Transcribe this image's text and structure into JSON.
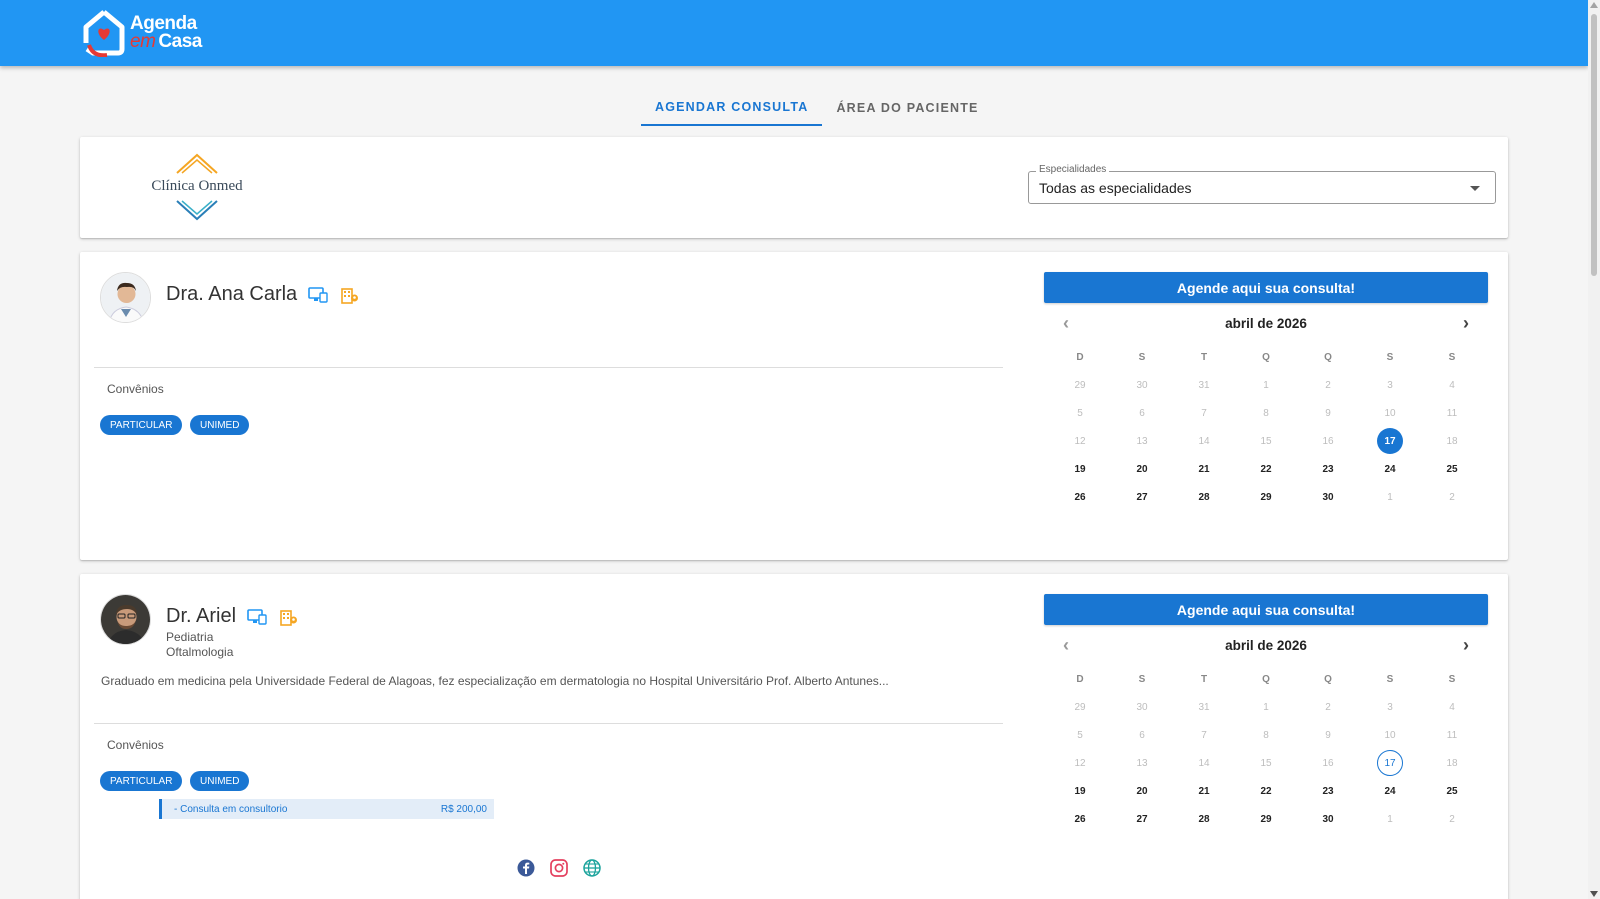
{
  "header": {
    "logo_line1": "Agenda",
    "logo_line2_em": "em",
    "logo_line2": "Casa"
  },
  "tabs": [
    {
      "label": "Agendar consulta",
      "active": true
    },
    {
      "label": "Área do paciente",
      "active": false
    }
  ],
  "clinic": {
    "name": "Clínica Onmed",
    "specialties_label": "Especialidades",
    "specialties_value": "Todas as especialidades"
  },
  "doctors": [
    {
      "name": "Dra. Ana Carla",
      "specialties": [],
      "description": "",
      "convenios_label": "Convênios",
      "convenios": [
        "PARTICULAR",
        "UNIMED"
      ],
      "calendar": {
        "button": "Agende aqui sua consulta!",
        "month": "abril de 2026",
        "selected": "17"
      }
    },
    {
      "name": "Dr. Ariel",
      "specialties": [
        "Pediatria",
        "Oftalmologia"
      ],
      "description": "Graduado em medicina pela Universidade Federal de Alagoas, fez especialização em dermatologia no Hospital Universitário Prof. Alberto Antunes...",
      "convenios_label": "Convênios",
      "convenios": [
        "PARTICULAR",
        "UNIMED"
      ],
      "price_item": "- Consulta em consultorio",
      "price_value": "R$ 200,00",
      "social": [
        "facebook-icon",
        "instagram-icon",
        "website-icon"
      ],
      "calendar": {
        "button": "Agende aqui sua consulta!",
        "month": "abril de 2026",
        "today": "17"
      }
    }
  ],
  "calendar_common": {
    "weekdays": [
      "D",
      "S",
      "T",
      "Q",
      "Q",
      "S",
      "S"
    ],
    "days": [
      [
        "29",
        "30",
        "31",
        "1",
        "2",
        "3",
        "4"
      ],
      [
        "5",
        "6",
        "7",
        "8",
        "9",
        "10",
        "11"
      ],
      [
        "12",
        "13",
        "14",
        "15",
        "16",
        "17",
        "18"
      ],
      [
        "19",
        "20",
        "21",
        "22",
        "23",
        "24",
        "25"
      ],
      [
        "26",
        "27",
        "28",
        "29",
        "30",
        "1",
        "2"
      ]
    ],
    "available_from_row_col": [
      2,
      6
    ],
    "last_available_row_col": [
      4,
      4
    ]
  },
  "colors": {
    "primary": "#2196f3",
    "button": "#1976d2",
    "accent_orange": "#f5a623"
  }
}
